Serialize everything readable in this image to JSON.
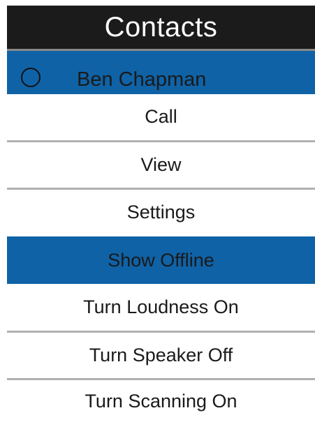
{
  "header": {
    "title": "Contacts"
  },
  "contact": {
    "name": "Ben Chapman",
    "status_icon": "presence-circle-icon"
  },
  "menu": {
    "items": [
      {
        "label": "Call",
        "selected": false
      },
      {
        "label": "View",
        "selected": false
      },
      {
        "label": "Settings",
        "selected": false
      },
      {
        "label": "Show Offline",
        "selected": true
      },
      {
        "label": "Turn Loudness On",
        "selected": false
      },
      {
        "label": "Turn Speaker Off",
        "selected": false
      },
      {
        "label": "Turn Scanning On",
        "selected": false
      }
    ]
  },
  "colors": {
    "header_bg": "#1b1b1b",
    "header_text": "#ffffff",
    "highlight": "#0f62a6",
    "divider": "#b0b0b0",
    "text": "#1a1a1a"
  }
}
